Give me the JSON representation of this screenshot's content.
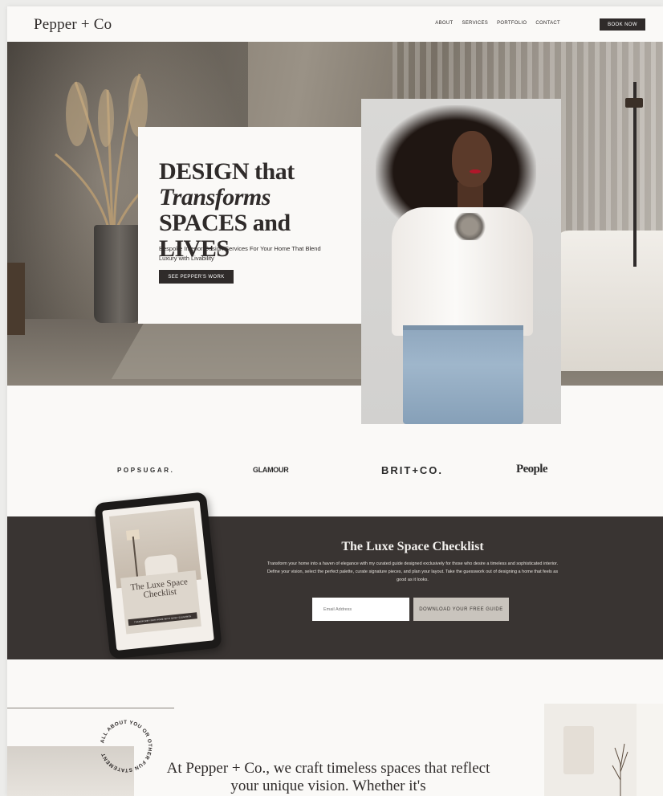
{
  "header": {
    "logo": "Pepper + Co",
    "nav": [
      {
        "label": "ABOUT"
      },
      {
        "label": "SERVICES"
      },
      {
        "label": "PORTFOLIO"
      },
      {
        "label": "CONTACT"
      }
    ],
    "book_button": "BOOK NOW"
  },
  "hero": {
    "title_line1": "DESIGN that",
    "title_line2": "Transforms",
    "title_line3": "SPACES and LIVES",
    "subtitle": "Bespoke Interior Design Services For Your Home That Blend Luxury with Livability",
    "cta": "SEE PEPPER'S WORK"
  },
  "press": {
    "logos": [
      "POPSUGAR.",
      "GLAMOUR",
      "BRIT+CO.",
      "People"
    ]
  },
  "checklist": {
    "title": "The Luxe Space Checklist",
    "body": "Transform your home into a haven of elegance with my curated guide designed exclusively for those who desire a timeless and sophisticated interior. Define your vision, select the perfect palette, curate signature pieces, and plan your layout. Take the guesswork out of designing a home that feels as good as it looks.",
    "email_placeholder": "Email Address",
    "download_button": "DOWNLOAD YOUR FREE GUIDE",
    "tablet_title": "The Luxe Space Checklist",
    "tablet_bar": "TRANSFORM YOUR HOME WITH QUIET ELEGANCE"
  },
  "about": {
    "circle_text": "ALL ABOUT YOU OR OTHER FUN STATEMENT",
    "headline": "At Pepper + Co., we craft timeless spaces that reflect your unique vision. Whether it's"
  },
  "colors": {
    "dark": "#2f2b2a",
    "band": "#393432",
    "page": "#faf9f7",
    "button_light": "#c9c4bd"
  }
}
